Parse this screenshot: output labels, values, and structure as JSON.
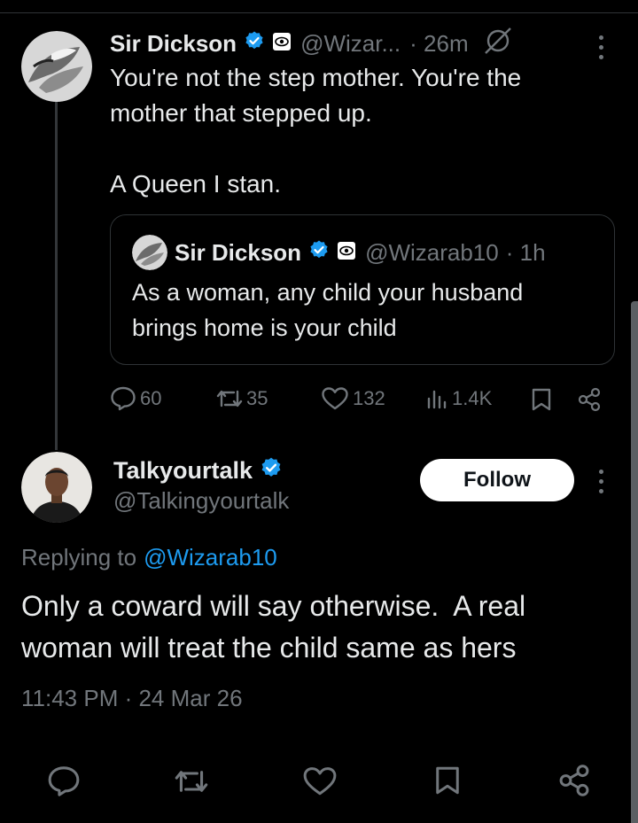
{
  "parent_tweet": {
    "display_name": "Sir Dickson",
    "handle": "@Wizar...",
    "time": "· 26m",
    "text_line1": "You're not the step mother. You're the",
    "text_line2": "mother that stepped up.",
    "text_line3": "A Queen I stan.",
    "quoted": {
      "display_name": "Sir Dickson",
      "handle": "@Wizarab10",
      "time": "· 1h",
      "text_line1": "As a woman, any child your husband",
      "text_line2": "brings home is your child"
    },
    "stats": {
      "replies": "60",
      "reposts": "35",
      "likes": "132",
      "views": "1.4K"
    }
  },
  "reply_tweet": {
    "display_name": "Talkyourtalk",
    "handle": "@Talkingyourtalk",
    "follow_label": "Follow",
    "replying_prefix": "Replying to",
    "replying_handle": "@Wizarab10",
    "text_line1": "Only a coward will say otherwise.  A real",
    "text_line2": "woman will treat the child same as hers",
    "timestamp": "11:43 PM · 24 Mar 26"
  },
  "colors": {
    "background": "#000000",
    "text": "#e7e9ea",
    "muted": "#71767b",
    "accent": "#1d9bf0",
    "border": "#2f3336"
  },
  "icons": [
    "verified-badge-icon",
    "affiliate-badge-icon",
    "grok-icon",
    "more-icon",
    "reply-icon",
    "repost-icon",
    "like-icon",
    "views-icon",
    "bookmark-icon",
    "share-icon"
  ]
}
